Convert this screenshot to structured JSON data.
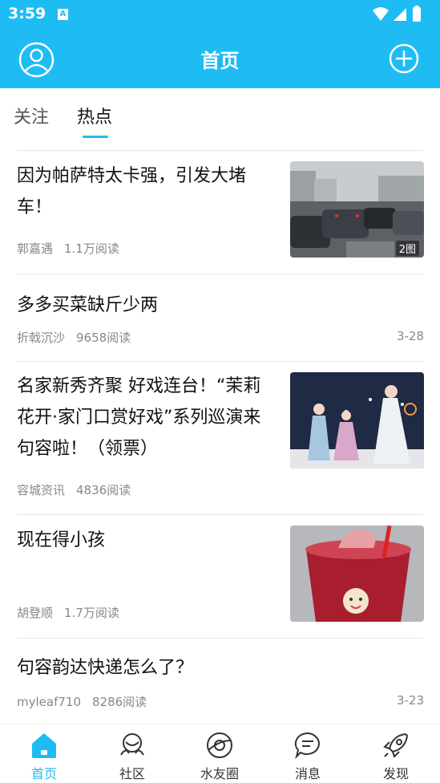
{
  "status_bar": {
    "time": "3:59",
    "notification_badge": "A"
  },
  "header": {
    "title": "首页"
  },
  "tabs": [
    {
      "label": "关注"
    },
    {
      "label": "热点"
    }
  ],
  "feed": [
    {
      "title_line1": "因为帕萨特太卡强，引发大堵",
      "title_line2": "车！",
      "author": "郭嘉遇",
      "reads": "1.1万阅读",
      "image_count": "2图"
    },
    {
      "title_line1": "多多买菜缺斤少两",
      "author": "折戟沉沙",
      "reads": "9658阅读",
      "date": "3-28"
    },
    {
      "title_line1": "名家新秀齐聚 好戏连台！“茉莉",
      "title_line2": "花开·家门口赏好戏”系列巡演来",
      "title_line3": "句容啦！（领票）",
      "author": "容城资讯",
      "reads": "4836阅读"
    },
    {
      "title_line1": "现在得小孩",
      "author": "胡登顺",
      "reads": "1.7万阅读"
    },
    {
      "title_line1": "句容韵达快递怎么了？",
      "author": "myleaf710",
      "reads": "8286阅读",
      "date": "3-23"
    }
  ],
  "bottom_nav": [
    {
      "label": "首页",
      "icon": "home-icon",
      "active": true
    },
    {
      "label": "社区",
      "icon": "community-icon"
    },
    {
      "label": "水友圈",
      "icon": "planet-icon"
    },
    {
      "label": "消息",
      "icon": "message-icon"
    },
    {
      "label": "发现",
      "icon": "rocket-icon"
    }
  ],
  "colors": {
    "brand": "#1ebcf3",
    "text": "#111111",
    "meta": "#888888"
  }
}
